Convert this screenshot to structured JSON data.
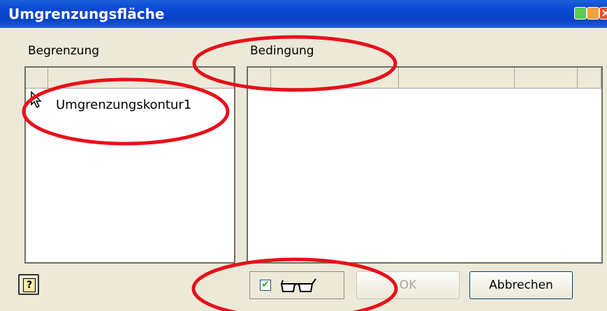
{
  "window": {
    "title": "Umgrenzungsfläche",
    "close_glyph": "×"
  },
  "left_panel": {
    "label": "Begrenzung",
    "items": [
      {
        "label": "Umgrenzungskontur1"
      }
    ]
  },
  "right_panel": {
    "label": "Bedingung"
  },
  "footer": {
    "help_glyph": "?",
    "preview_checked_glyph": "✔",
    "ok_label": "OK",
    "cancel_label": "Abbrechen"
  },
  "colors": {
    "titlebar": "#0a4ad6",
    "annotation": "#e8101a",
    "dialog_bg": "#ece9d8"
  },
  "icons": [
    "help-icon",
    "glasses-icon",
    "cursor-icon",
    "minimize-icon",
    "maximize-icon",
    "close-icon"
  ]
}
